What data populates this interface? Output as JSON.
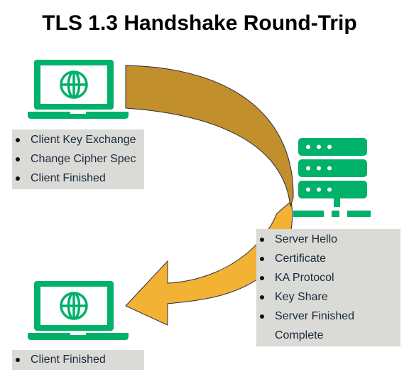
{
  "title": "TLS 1.3 Handshake Round-Trip",
  "colors": {
    "device_green": "#00b16a",
    "arrow_top": "#c18f2c",
    "arrow_bottom": "#f2b233",
    "arrow_outline": "#2d2a45",
    "box_bg": "#dadad6",
    "text": "#1b2a3a"
  },
  "nodes": {
    "client_top": {
      "icon": "laptop-globe-icon"
    },
    "server": {
      "icon": "server-rack-icon"
    },
    "client_bottom": {
      "icon": "laptop-globe-icon"
    }
  },
  "client_messages": {
    "items": [
      {
        "label": "Client Key Exchange",
        "bullet": true
      },
      {
        "label": "Change Cipher Spec",
        "bullet": true
      },
      {
        "label": "Client Finished",
        "bullet": true
      }
    ]
  },
  "server_messages": {
    "items": [
      {
        "label": "Server Hello",
        "bullet": true
      },
      {
        "label": "Certificate",
        "bullet": true
      },
      {
        "label": "KA Protocol",
        "bullet": true
      },
      {
        "label": "Key Share",
        "bullet": true
      },
      {
        "label": "Server Finished",
        "bullet": true
      },
      {
        "label": "Complete",
        "bullet": false
      }
    ]
  },
  "final_messages": {
    "items": [
      {
        "label": "Client Finished",
        "bullet": true
      }
    ]
  }
}
